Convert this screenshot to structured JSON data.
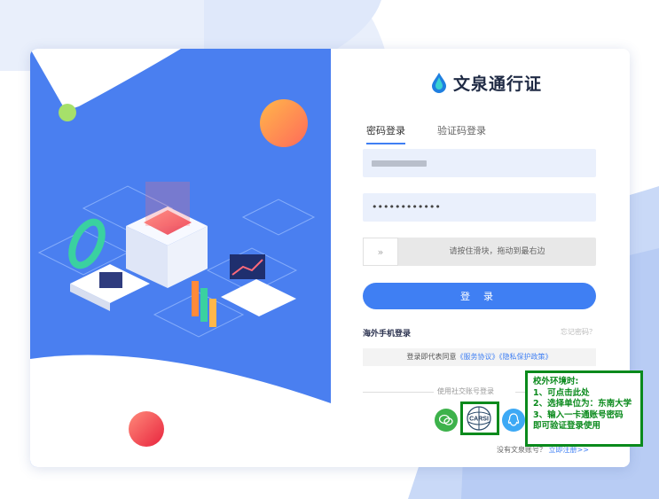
{
  "brand": {
    "title": "文泉通行证",
    "logo_icon": "droplet-logo-icon"
  },
  "tabs": [
    {
      "label": "密码登录",
      "active": true
    },
    {
      "label": "验证码登录",
      "active": false
    }
  ],
  "form": {
    "password_value": "••••••••••••",
    "slider_text": "请按住滑块，拖动到最右边",
    "slider_handle": "»",
    "login_label": "登 录"
  },
  "links": {
    "overseas_login": "海外手机登录",
    "forgot_password": "忘记密码？"
  },
  "agreement": {
    "prefix": "登录即代表同意",
    "service": "《服务协议》",
    "privacy": "《隐私保护政策》"
  },
  "social": {
    "label": "使用社交账号登录",
    "wechat_icon": "wechat-icon",
    "carsi_label": "CARSI",
    "qq_icon": "qq-icon"
  },
  "signup": {
    "prompt": "没有文泉账号？",
    "link": "立即注册>>"
  },
  "annotation": {
    "line1": "校外环境时:",
    "line2": "1、可点击此处",
    "line3": "2、选择单位为：东南大学",
    "line4": "3、输入一卡通账号密码",
    "line5": "即可验证登录使用"
  },
  "colors": {
    "accent": "#3f7ff3",
    "panel": "#4a7ff0",
    "annotation": "#0a8a1c"
  }
}
